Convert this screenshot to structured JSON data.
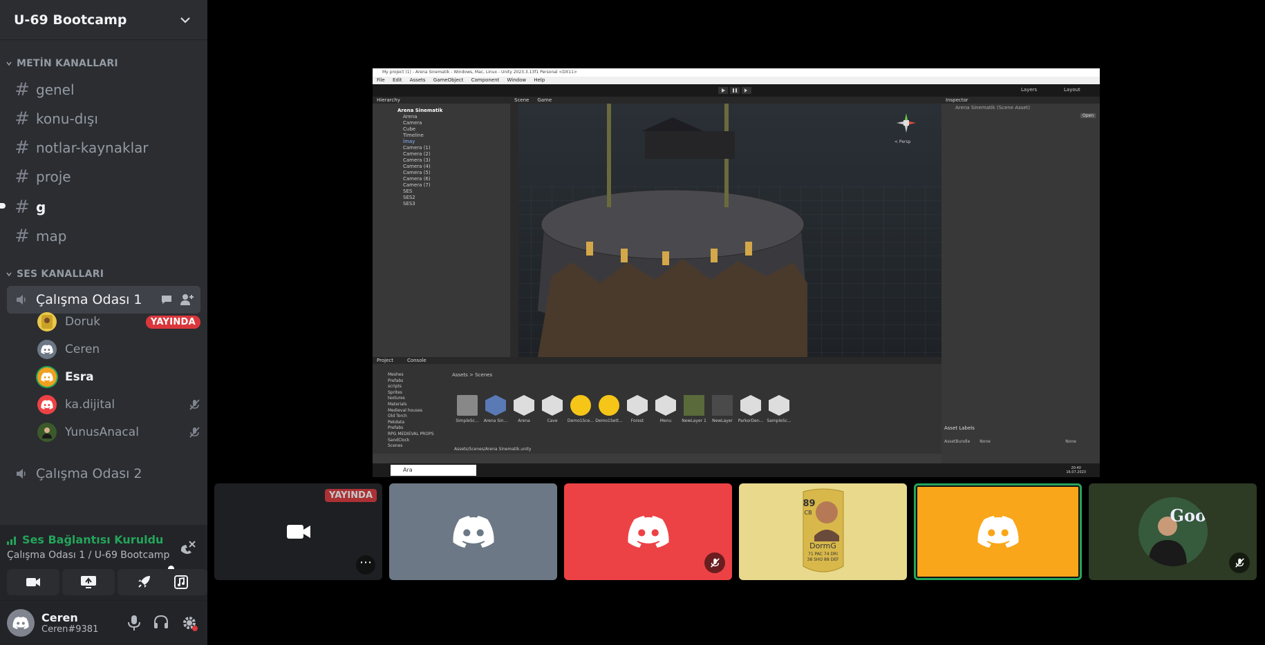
{
  "server": {
    "name": "U-69 Bootcamp"
  },
  "text_category": {
    "label": "METİN KANALLARI"
  },
  "text_channels": [
    {
      "name": "genel",
      "unread": false
    },
    {
      "name": "konu-dışı",
      "unread": false
    },
    {
      "name": "notlar-kaynaklar",
      "unread": false
    },
    {
      "name": "proje",
      "unread": false
    },
    {
      "name": "g",
      "unread": true
    },
    {
      "name": "map",
      "unread": false
    }
  ],
  "voice_category": {
    "label": "SES KANALLARI"
  },
  "voice_channels": [
    {
      "name": "Çalışma Odası 1",
      "active": true
    },
    {
      "name": "Çalışma Odası 2",
      "active": false
    }
  ],
  "voice_users": [
    {
      "name": "Doruk",
      "badge": "YAYINDA",
      "speaking": false,
      "muted": false,
      "avatar_color": "#e8c84a"
    },
    {
      "name": "Ceren",
      "badge": "",
      "speaking": false,
      "muted": false,
      "avatar_color": "#6d7886"
    },
    {
      "name": "Esra",
      "badge": "",
      "speaking": true,
      "muted": false,
      "avatar_color": "#f0a020"
    },
    {
      "name": "ka.dijital",
      "badge": "",
      "speaking": false,
      "muted": true,
      "avatar_color": "#ed4245"
    },
    {
      "name": "YunusAnacal",
      "badge": "",
      "speaking": false,
      "muted": true,
      "avatar_color": "#3b5a2a"
    }
  ],
  "voice_panel": {
    "status": "Ses Bağlantısı Kuruldu",
    "subtitle": "Çalışma Odası 1 / U-69 Bootcamp"
  },
  "user_panel": {
    "name": "Ceren",
    "tag": "Ceren#9381"
  },
  "stream": {
    "title": "My project (1) - Arena Sinematik - Windows, Mac, Linux - Unity 2023.3.13f1 Personal <DX11>",
    "menu": [
      "File",
      "Edit",
      "Assets",
      "GameObject",
      "Component",
      "Window",
      "Help"
    ],
    "hierarchy_tab": "Hierarchy",
    "scene_tab": "Scene",
    "game_tab": "Game",
    "inspector_tab": "Inspector",
    "inspector_title": "Arena Sinematik (Scene Asset)",
    "open_btn": "Open",
    "hierarchy_items": [
      "Arena Sinematik",
      "Arena",
      "Camera",
      "Cube",
      "Timeline",
      "İmay",
      "Camera (1)",
      "Camera (2)",
      "Camera (3)",
      "Camera (4)",
      "Camera (5)",
      "Camera (6)",
      "Camera (7)",
      "SES",
      "SES2",
      "SES3"
    ],
    "project_tab": "Project",
    "console_tab": "Console",
    "breadcrumb": "Assets > Scenes",
    "folders": [
      "Meshes",
      "Prefabs",
      "scripts",
      "Sprites",
      "textures",
      "Materials",
      "Medieval houses",
      "Old Torch",
      "Pekdata",
      "Prefabs",
      "RPG MEDIEVAL PROPS",
      "SandClock",
      "Scenes"
    ],
    "assets": [
      "SimpleSc...",
      "Arena Sin...",
      "Arena",
      "Cave",
      "Demo1Sce...",
      "Demo1Sett...",
      "Forest",
      "Menu",
      "NewLayer 1",
      "NewLayer",
      "ParkorDen...",
      "SampleSc..."
    ],
    "status_path": "Assets/Scenes/Arena Sinematik.unity",
    "persp": "< Persp",
    "asset_labels": "Asset Labels",
    "asset_bundle": "AssetBundle",
    "none1": "None",
    "none2": "None",
    "layers": "Layers",
    "layout": "Layout",
    "taskbar_search": "Ara",
    "clock_time": "20:40",
    "clock_date": "16.07.2023"
  },
  "tiles": [
    {
      "type": "stream",
      "label": "YAYINDA",
      "bg": "#1e1f22"
    },
    {
      "type": "logo",
      "bg": "#6d7886",
      "muted": false
    },
    {
      "type": "logo",
      "bg": "#ed4245",
      "muted": true
    },
    {
      "type": "card",
      "bg": "#e8d98c",
      "card_name": "DormG",
      "card_rating": "89",
      "card_pos": "CB",
      "stats": "71 PAC  74 DRI",
      "stats2": "38 SHO  88 DEF"
    },
    {
      "type": "logo",
      "bg": "#faa61a",
      "speaking": true
    },
    {
      "type": "photo",
      "bg": "#2d3a24",
      "muted": true,
      "photo_text": "Goo"
    }
  ]
}
